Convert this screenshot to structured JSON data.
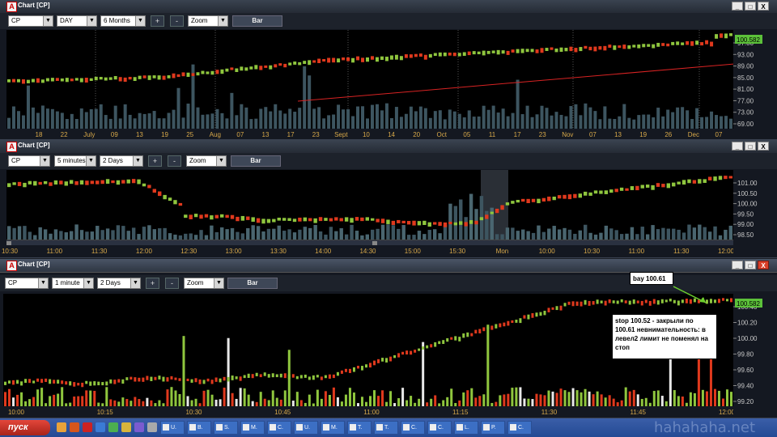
{
  "windows": [
    {
      "title": "Chart [CP]",
      "symbol": "CP",
      "interval": "DAY",
      "range": "6 Months",
      "zoom": "Zoom",
      "bar": "Bar",
      "plus": "+",
      "minus": "-",
      "last_price": "100.582",
      "price_ticks": [
        "97.00",
        "93.00",
        "89.00",
        "85.00",
        "81.00",
        "77.00",
        "73.00",
        "69.00"
      ],
      "time_ticks": [
        "18",
        "22",
        "July",
        "09",
        "13",
        "19",
        "25",
        "Aug",
        "07",
        "13",
        "17",
        "23",
        "Sept",
        "10",
        "14",
        "20",
        "Oct",
        "05",
        "11",
        "17",
        "23",
        "Nov",
        "07",
        "13",
        "19",
        "26",
        "Dec",
        "07"
      ],
      "max_btn": "□",
      "min_btn": "_",
      "close_btn": "X"
    },
    {
      "title": "Chart [CP]",
      "symbol": "CP",
      "interval": "5 minutes",
      "range": "2 Days",
      "zoom": "Zoom",
      "bar": "Bar",
      "plus": "+",
      "minus": "-",
      "price_ticks": [
        "101.00",
        "100.50",
        "100.00",
        "99.50",
        "99.00",
        "98.50"
      ],
      "time_ticks": [
        "10:30",
        "11:00",
        "11:30",
        "12:00",
        "12:30",
        "13:00",
        "13:30",
        "14:00",
        "14:30",
        "15:00",
        "15:30",
        "Mon",
        "10:00",
        "10:30",
        "11:00",
        "11:30",
        "12:00"
      ],
      "max_btn": "□",
      "min_btn": "_",
      "close_btn": "X"
    },
    {
      "title": "Chart [CP]",
      "symbol": "CP",
      "interval": "1 minute",
      "range": "2 Days",
      "zoom": "Zoom",
      "bar": "Bar",
      "plus": "+",
      "minus": "-",
      "last_price": "100.582",
      "price_ticks": [
        "100.40",
        "100.20",
        "100.00",
        "99.80",
        "99.60",
        "99.40",
        "99.20"
      ],
      "time_ticks": [
        "10:00",
        "10:15",
        "10:30",
        "10:45",
        "11:00",
        "11:15",
        "11:30",
        "11:45",
        "12:00"
      ],
      "max_btn": "□",
      "min_btn": "_",
      "close_btn": "X"
    }
  ],
  "annotations": {
    "bay": "bay 100.61",
    "note": "stop 100.52 - закрыли по 100.61 невнимательность: в левел2 лимит не поменял на стоп"
  },
  "taskbar": {
    "start": "пуск",
    "items": [
      "U.",
      "B.",
      "S.",
      "M.",
      "C.",
      "U.",
      "M.",
      "T.",
      "T.",
      "C.",
      "C.",
      "L.",
      "P.",
      "C."
    ]
  },
  "watermark": "hahahaha.net",
  "colors": {
    "up": "#8fc63e",
    "down": "#e0391d",
    "volume": "#3d5560",
    "trend": "#d82323",
    "price_tag": "#5cc13a"
  }
}
